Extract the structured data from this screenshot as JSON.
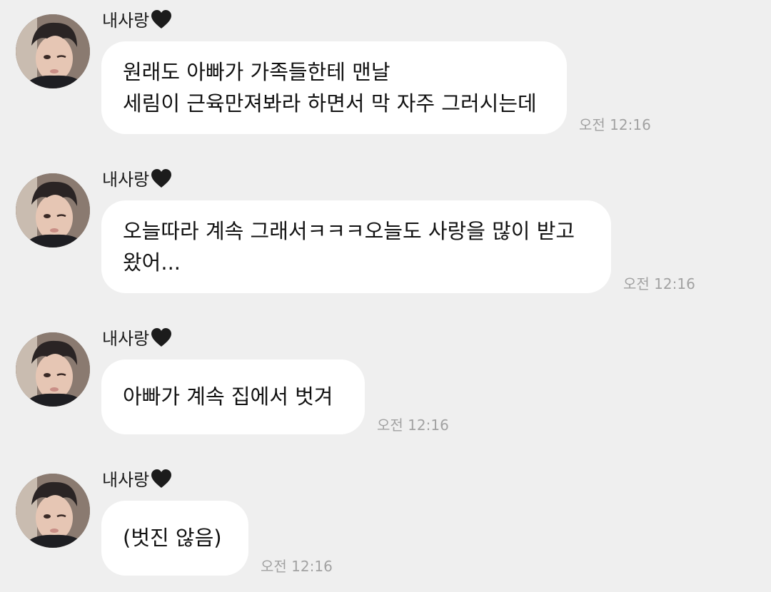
{
  "colors": {
    "background": "#efefef",
    "bubble": "#ffffff",
    "timestamp": "#a2a2a2",
    "heart": "#1c1c1c"
  },
  "messages": [
    {
      "sender": "내사랑",
      "sender_icon": "black-heart-icon",
      "lines": [
        "원래도 아빠가 가족들한테 맨날",
        "세림이 근육만져봐라 하면서 막 자주 그러시는데"
      ],
      "time": "오전 12:16"
    },
    {
      "sender": "내사랑",
      "sender_icon": "black-heart-icon",
      "lines": [
        "오늘따라 계속 그래서ㅋㅋㅋ오늘도 사랑을 많이 받고",
        "왔어..."
      ],
      "time": "오전 12:16"
    },
    {
      "sender": "내사랑",
      "sender_icon": "black-heart-icon",
      "lines": [
        "아빠가 계속 집에서 벗겨"
      ],
      "time": "오전 12:16"
    },
    {
      "sender": "내사랑",
      "sender_icon": "black-heart-icon",
      "lines": [
        "(벗진 않음)"
      ],
      "time": "오전 12:16"
    }
  ]
}
